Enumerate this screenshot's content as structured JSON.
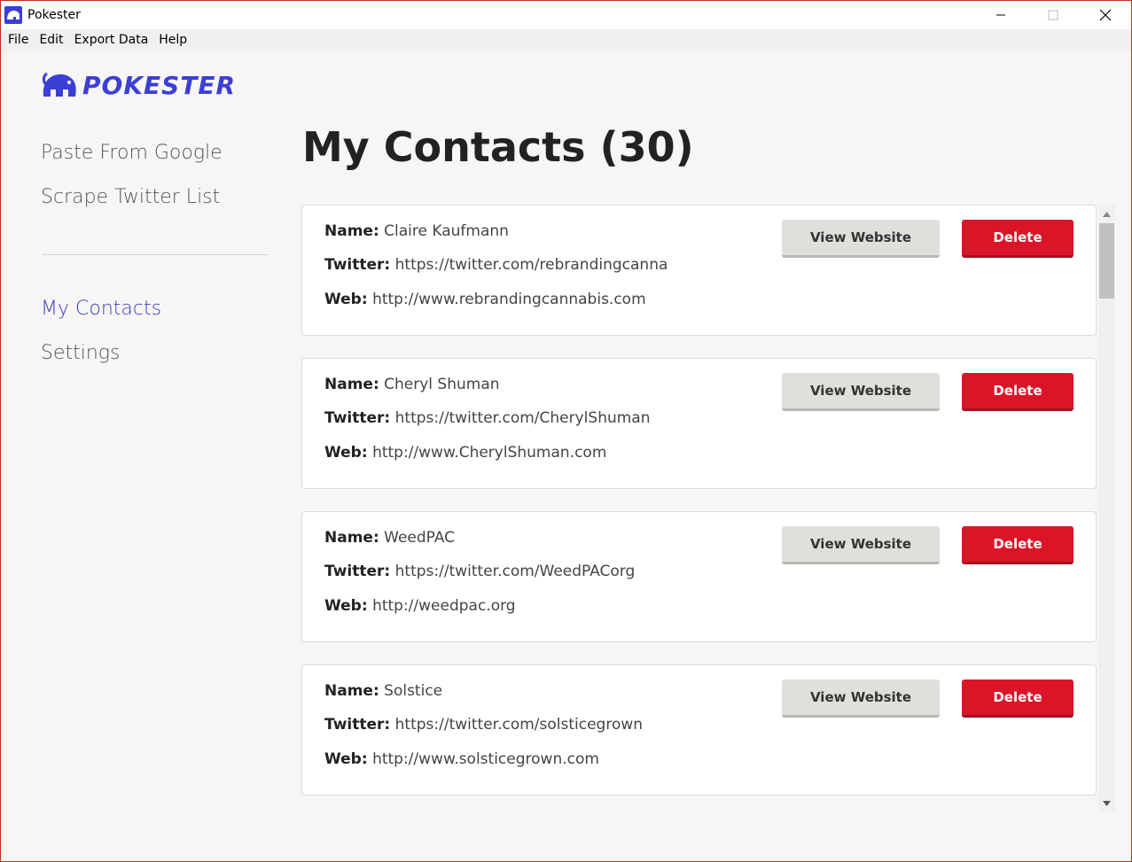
{
  "window": {
    "title": "Pokester"
  },
  "menu": [
    "File",
    "Edit",
    "Export Data",
    "Help"
  ],
  "brand": {
    "name": "POKESTER",
    "color": "#3b3fd6"
  },
  "nav": {
    "top": [
      "Paste From Google",
      "Scrape Twitter List"
    ],
    "bottom": [
      "My Contacts",
      "Settings"
    ],
    "active": "My Contacts"
  },
  "page": {
    "title": "My Contacts (30)"
  },
  "labels": {
    "name": "Name:",
    "twitter": "Twitter:",
    "web": "Web:",
    "view": "View Website",
    "delete": "Delete"
  },
  "contacts": [
    {
      "name": "Claire Kaufmann",
      "twitter": "https://twitter.com/rebrandingcanna",
      "web": "http://www.rebrandingcannabis.com"
    },
    {
      "name": "Cheryl Shuman",
      "twitter": "https://twitter.com/CherylShuman",
      "web": "http://www.CherylShuman.com"
    },
    {
      "name": "WeedPAC",
      "twitter": "https://twitter.com/WeedPACorg",
      "web": "http://weedpac.org"
    },
    {
      "name": "Solstice",
      "twitter": "https://twitter.com/solsticegrown",
      "web": "http://www.solsticegrown.com"
    }
  ],
  "colors": {
    "accent": "#3b3fc4",
    "danger": "#dc1428",
    "background": "#f7f6f4"
  }
}
